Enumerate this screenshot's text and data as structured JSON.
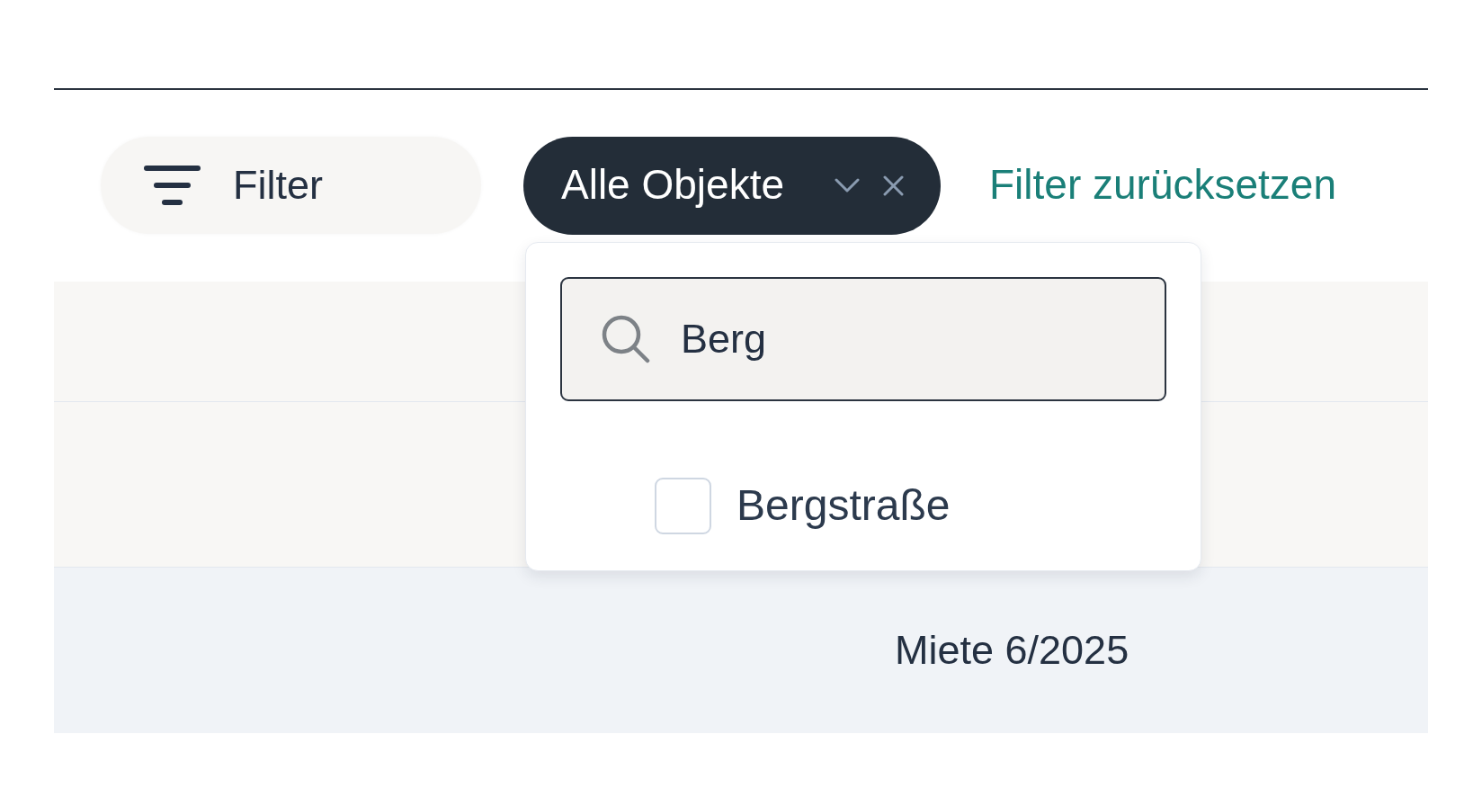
{
  "toolbar": {
    "filter_button": {
      "label": "Filter"
    },
    "object_filter": {
      "label": "Alle Objekte",
      "expanded": true,
      "menu": {
        "search": {
          "value": "Berg"
        },
        "options": [
          {
            "label": "Bergstraße",
            "checked": false
          }
        ]
      }
    },
    "reset_link": {
      "label": "Filter zurücksetzen"
    }
  },
  "table": {
    "rows": [
      {
        "kind": "header"
      },
      {
        "kind": "data",
        "selected": false
      },
      {
        "kind": "data",
        "selected": true,
        "column_2": "Miete 6/2025"
      }
    ]
  }
}
